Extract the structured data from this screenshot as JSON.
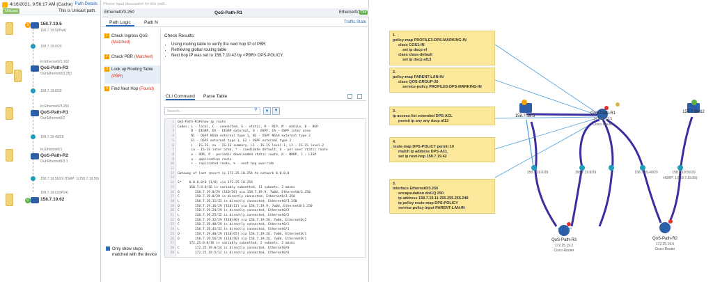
{
  "left": {
    "datetime": "4/16/2021, 9:56:17 AM (Cache)",
    "path_details": "Path Details",
    "badge": "Unicast",
    "unicast_text": "This is Unicast path.",
    "nodes": [
      {
        "title": "158.7.19.5",
        "sub": "158.7.19.5(IPv4)"
      },
      {
        "title": "158.7.19.0/29",
        "sub": ""
      },
      {
        "title": "QoS-Path-R3",
        "sub": "In:Ethernet0/1.102",
        "sub2": "Out:Ethernet0/3.250"
      },
      {
        "title": "158.7.19.8/29",
        "sub": ""
      },
      {
        "title": "QoS-Path-R1",
        "sub": "In:Ethernet0/3.250",
        "sub2": "Out:Ethernet0/2"
      },
      {
        "title": "158.7.19.40/29",
        "sub": ""
      },
      {
        "title": "QoS-Path-R2",
        "sub": "In:Ethernet0/1",
        "sub2": "Out:Ethernet0/3.1"
      },
      {
        "title": "158.7.19.56/29 HSRP: 1(158.7.19.59)",
        "sub": ""
      },
      {
        "title": "158.7.19.62",
        "sub": "158.7.19.62(IPv4)"
      }
    ]
  },
  "mid": {
    "description_placeholder": "Please input description for this path...",
    "header_left": "Ethernet0/3.250",
    "header_center": "QoS-Path-R1",
    "header_right": "Ethernet0/1",
    "header_badge": "Out",
    "tab1": "Path Logic",
    "tab2": "Path N",
    "traffic_state": "Traffic State",
    "steps": [
      {
        "num": "1",
        "label": "Check Ingress QoS",
        "status": "(Matched)"
      },
      {
        "num": "2",
        "label": "Check PBR",
        "status": "(Matched)"
      },
      {
        "num": "3",
        "label": "Look up Routing Table",
        "status": "(PBR)"
      },
      {
        "num": "4",
        "label": "Find Next Hop",
        "status": "(Found)"
      }
    ],
    "show_steps": "Only show steps matched with the device",
    "check_results_title": "Check Results:",
    "check_results": [
      "Using routing table to verify the next hop IP of PBR",
      "Retrieving global routing table",
      "Next hop IP was set to 158.7.19.42 by <PBR> DPS-POLICY"
    ],
    "cli_tab": "CLI Command",
    "parse_tab": "Parse Table",
    "search_placeholder": "Search...",
    "code_lines": [
      {
        "n": "1",
        "t": "QoS-Path-R1#show ip route"
      },
      {
        "n": "2",
        "t": "Codes: L - local, C - connected, S - static, R - RIP, M - mobile, B - BGP"
      },
      {
        "n": "3",
        "t": "       D - EIGRP, EX - EIGRP external, O - OSPF, IA - OSPF inter area"
      },
      {
        "n": "4",
        "t": "       N1 - OSPF NSSA external type 1, N2 - OSPF NSSA external type 2"
      },
      {
        "n": "5",
        "t": "       E1 - OSPF external type 1, E2 - OSPF external type 2"
      },
      {
        "n": "6",
        "t": "       i - IS-IS, su - IS-IS summary, L1 - IS-IS level-1, L2 - IS-IS level-2"
      },
      {
        "n": "7",
        "t": "       ia - IS-IS inter area, * - candidate default, U - per-user static route"
      },
      {
        "n": "8",
        "t": "       o - ODR, P - periodic downloaded static route, H - NHRP, l - LISP"
      },
      {
        "n": "9",
        "t": "       a - application route"
      },
      {
        "n": "10",
        "t": "       + - replicated route, % - next hop override"
      },
      {
        "n": "11",
        "t": ""
      },
      {
        "n": "12",
        "t": "Gateway of last resort is 172.25.10.254 to network 0.0.0.0"
      },
      {
        "n": "13",
        "t": ""
      },
      {
        "n": "14",
        "t": "S*    0.0.0.0/0 [1/0] via 172.25.10.254"
      },
      {
        "n": "15",
        "t": "      158.7.0.0/16 is variably subnetted, 11 subnets, 2 masks"
      },
      {
        "n": "16",
        "t": "O        158.7.19.0/29 [110/20] via 158.7.19.9, 7w0d, Ethernet0/3.250"
      },
      {
        "n": "17",
        "t": "C        158.7.19.8/29 is directly connected, Ethernet0/3.250"
      },
      {
        "n": "18",
        "t": "L        158.7.19.11/32 is directly connected, Ethernet0/3.250"
      },
      {
        "n": "19",
        "t": "O        158.7.19.16/29 [110/11] via 158.7.19.9, 7w0d, Ethernet0/3.250"
      },
      {
        "n": "20",
        "t": "C        158.7.19.24/29 is directly connected, Ethernet0/2"
      },
      {
        "n": "21",
        "t": "L        158.7.19.25/32 is directly connected, Ethernet0/2"
      },
      {
        "n": "22",
        "t": "O        158.7.19.32/29 [110/40] via 158.7.19.26, 7w0d, Ethernet0/2"
      },
      {
        "n": "23",
        "t": "C        158.7.19.40/29 is directly connected, Ethernet0/1"
      },
      {
        "n": "24",
        "t": "L        158.7.19.41/32 is directly connected, Ethernet0/1"
      },
      {
        "n": "25",
        "t": "O        158.7.19.48/29 [110/65] via 158.7.19.26, 7w0d, Ethernet0/1"
      },
      {
        "n": "26",
        "t": "O        158.7.19.56/29 [110/50] via 158.7.19.26, 7w0d, Ethernet0/1"
      },
      {
        "n": "27",
        "t": "      172.25.0.0/16 is variably subnetted, 2 subnets, 2 masks"
      },
      {
        "n": "28",
        "t": "C        172.25.19.0/24 is directly connected, Ethernet0/0"
      },
      {
        "n": "29",
        "t": "L        172.25.19.5/32 is directly connected, Ethernet0/0"
      }
    ]
  },
  "map": {
    "notes": [
      {
        "lines": [
          "1.",
          "policy-map PROFILE3-DPS-MARKING-IN",
          "  class COS1-IN",
          "    set ip dscp ef",
          "  class class-default",
          "    set ip dscp af13"
        ]
      },
      {
        "lines": [
          "2.",
          "policy-map PARENT-LAN-IN",
          "  class QOS-GROUP-30",
          "    service-policy PROFILE3-DPS-MARKING-IN"
        ]
      },
      {
        "lines": [
          "3.",
          "ip access-list extended DPS-ACL",
          "  permit ip any any dscp af13"
        ]
      },
      {
        "lines": [
          "4.",
          "route-map DPS-POLICY permit 10",
          "  match ip address DPS-ACL",
          "  set ip next-hop 158.7.19.42"
        ]
      },
      {
        "lines": [
          "5.",
          "interface Ethernet0/3.250",
          "  encapsulation dot1Q 250",
          "  ip address 158.7.19.11 255.255.255.248",
          "  ip policy route-map DPS-POLICY",
          "  service-policy input PARENT-LAN-IN"
        ]
      }
    ],
    "devices": [
      {
        "label": "158.7.19.5",
        "sub": ""
      },
      {
        "label": "QoS-Path-R1",
        "sub": "172.25.19.5",
        "sub2": "Cisco Router"
      },
      {
        "label": "158.7.19.62",
        "sub": ""
      },
      {
        "label": "158.7.19.0/29",
        "sub": ""
      },
      {
        "label": "158.7.19.8/29",
        "sub": ""
      },
      {
        "label": "158.7.19.40/29",
        "sub": ""
      },
      {
        "label": "158.7.19.56/29",
        "sub": "HSRP: 1(158.7.19.59)"
      },
      {
        "label": "QoS-Path-R3",
        "sub": "172.25.19.2",
        "sub2": "Cisco Router"
      },
      {
        "label": "QoS-Path-R2",
        "sub": "172.25.19.6",
        "sub2": "Cisco Router"
      }
    ]
  }
}
